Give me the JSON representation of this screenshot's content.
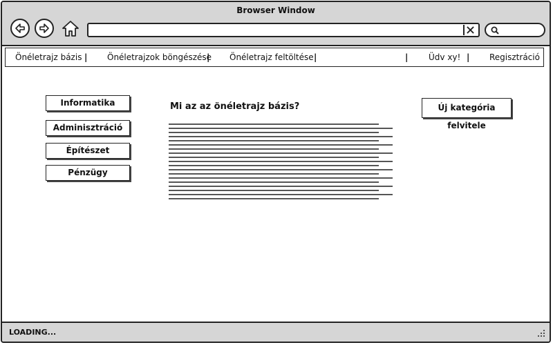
{
  "window": {
    "title": "Browser Window",
    "url": "",
    "status": "LOADING..."
  },
  "menu": {
    "items": [
      "Önéletrajz bázis",
      "Önéletrajzok böngészése",
      "Önéletrajz feltöltése"
    ],
    "greeting": "Üdv xy!",
    "register": "Regisztráció",
    "separator": "|"
  },
  "categories": [
    {
      "label": "Informatika"
    },
    {
      "label": "Adminisztráció"
    },
    {
      "label": "Építészet"
    },
    {
      "label": "Pénzügy"
    }
  ],
  "main": {
    "title": "Mi az az önéletrajz bázis?",
    "new_category_button": "Új kategória felvitele"
  },
  "icons": {
    "back": "arrow-left-icon",
    "forward": "arrow-right-icon",
    "home": "home-icon",
    "clear": "close-icon",
    "search": "search-icon",
    "grip": "resize-grip-icon"
  }
}
